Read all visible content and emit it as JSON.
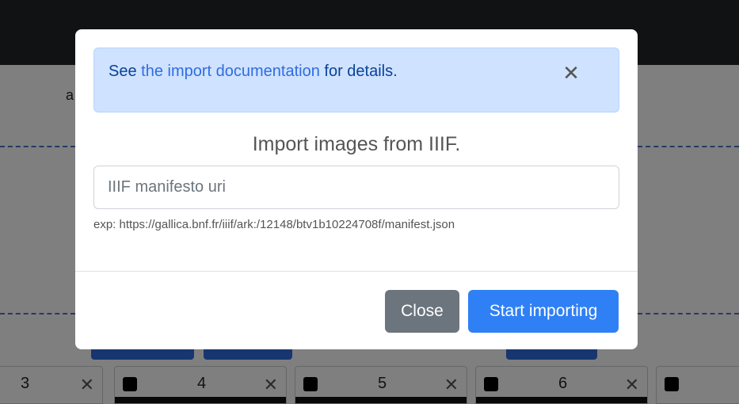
{
  "background": {
    "partial_letter": "a",
    "cards": [
      {
        "number": "3",
        "close": "✕"
      },
      {
        "number": "4",
        "close": "✕"
      },
      {
        "number": "5",
        "close": "✕"
      },
      {
        "number": "6",
        "close": "✕"
      },
      {
        "number": "",
        "close": ""
      }
    ]
  },
  "modal": {
    "alert": {
      "prefix": "See ",
      "link_text": "the import documentation",
      "suffix": " for details.",
      "close_icon": "✕"
    },
    "title": "Import images from IIIF.",
    "uri_input": {
      "placeholder": "IIIF manifesto uri",
      "value": ""
    },
    "hint": "exp: https://gallica.bnf.fr/iiif/ark:/12148/btv1b10224708f/manifest.json",
    "buttons": {
      "close": "Close",
      "start": "Start importing"
    }
  },
  "colors": {
    "primary": "#2f80f5",
    "secondary": "#6c757d",
    "alert_bg": "#cfe2ff",
    "navbar": "#212529"
  }
}
